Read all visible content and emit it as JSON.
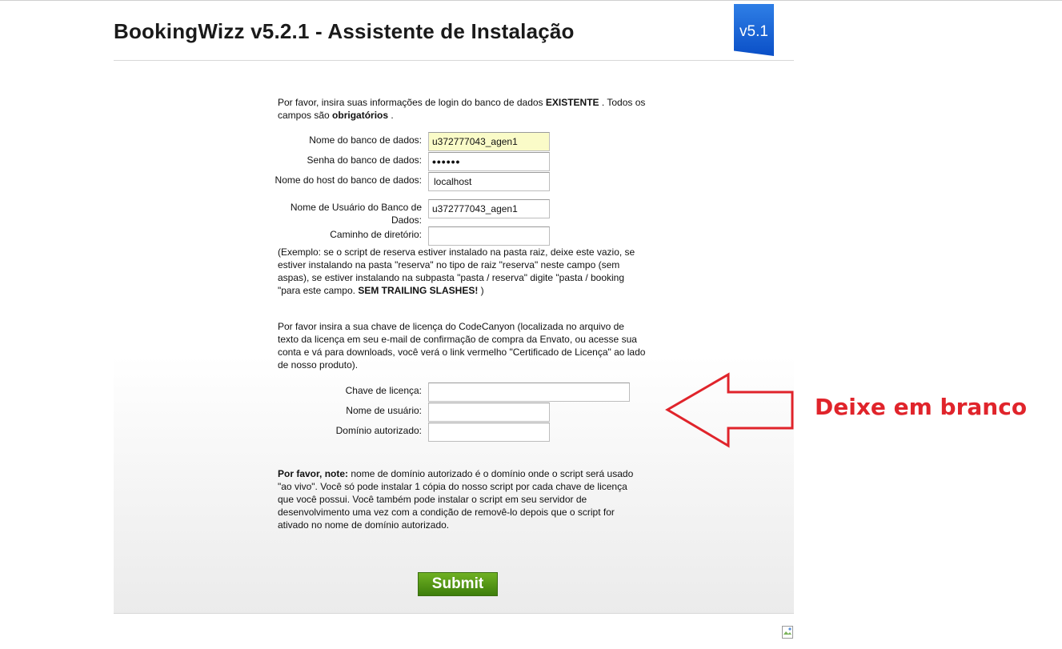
{
  "header": {
    "title": "BookingWizz v5.2.1 - Assistente de Instalação",
    "version_badge": "v5.1"
  },
  "intro": {
    "prefix": "Por favor, insira suas informações de login do banco de dados ",
    "existing": "EXISTENTE",
    "suffix": " . Todos os campos são ",
    "required": "obrigatórios",
    "end": " ."
  },
  "db_form": {
    "db_name_label": "Nome do banco de dados:",
    "db_name_value": "u372777043_agen1",
    "db_password_label": "Senha do banco de dados:",
    "db_password_value": "••••••",
    "db_host_label": "Nome do host do banco de dados:",
    "db_host_value": "localhost",
    "db_user_label": "Nome de Usuário do Banco de Dados:",
    "db_user_value": "u372777043_agen1",
    "path_label": "Caminho de diretório:",
    "path_value": ""
  },
  "example": {
    "text": "(Exemplo: se o script de reserva estiver instalado na pasta raiz, deixe este vazio, se estiver instalando na pasta \"reserva\" no tipo de raiz \"reserva\" neste campo (sem aspas), se estiver instalando na subpasta \"pasta / reserva\" digite \"pasta / booking \"para este campo. ",
    "bold": "SEM TRAILING SLASHES!",
    "end": " )"
  },
  "license": {
    "text": "Por favor insira a sua chave de licença do CodeCanyon (localizada no arquivo de texto da licença em seu e-mail de confirmação de compra da Envato, ou acesse sua conta e vá para downloads, você verá o link vermelho \"Certificado de Licença\" ao lado de nosso produto).",
    "key_label": "Chave de licença:",
    "key_value": "",
    "username_label": "Nome de usuário:",
    "username_value": "",
    "domain_label": "Domínio autorizado:",
    "domain_value": ""
  },
  "note": {
    "bold": "Por favor, note:",
    "text": " nome de domínio autorizado é o domínio onde o script será usado \"ao vivo\". Você só pode instalar 1 cópia do nosso script por cada chave de licença que você possui. Você também pode instalar o script em seu servidor de desenvolvimento uma vez com a condição de removê-lo depois que o script for ativado no nome de domínio autorizado."
  },
  "submit_label": "Submit",
  "annotation": {
    "text": "Deixe em branco",
    "color": "#e0242b"
  }
}
